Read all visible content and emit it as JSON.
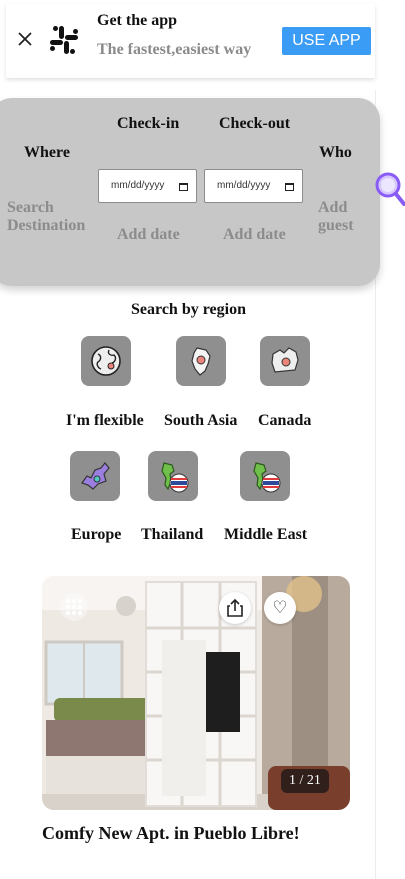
{
  "banner": {
    "title": "Get the app",
    "subtitle": "The fastest,easiest way",
    "use_app_label": "USE APP",
    "close_icon": "close-icon",
    "logo_icon": "slack-logo-icon",
    "button_color": "#3b9cf6"
  },
  "search": {
    "where_label": "Where",
    "where_placeholder": "Search Destination",
    "checkin_label": "Check-in",
    "checkout_label": "Check-out",
    "date_input_value": "mm/dd/yyyy",
    "checkin_add": "Add date",
    "checkout_add": "Add date",
    "who_label": "Who",
    "who_placeholder": "Add guest",
    "search_icon": "magnifier-icon",
    "panel_color": "#c7c7c7"
  },
  "regions": {
    "title": "Search by region",
    "items": [
      {
        "label": "I'm flexible",
        "icon": "globe-icon"
      },
      {
        "label": "South Asia",
        "icon": "south-asia-map-icon"
      },
      {
        "label": "Canada",
        "icon": "canada-map-icon"
      },
      {
        "label": "Europe",
        "icon": "europe-map-icon"
      },
      {
        "label": "Thailand",
        "icon": "thailand-map-icon"
      },
      {
        "label": "Middle East",
        "icon": "middle-east-map-icon"
      }
    ]
  },
  "listing": {
    "title": "Comfy New Apt. in Pueblo Libre!",
    "photo_counter": "1 / 21",
    "grid_icon": "grid-dots-icon",
    "share_icon": "share-icon",
    "favorite_icon": "heart-icon",
    "heart_glyph": "♡"
  }
}
